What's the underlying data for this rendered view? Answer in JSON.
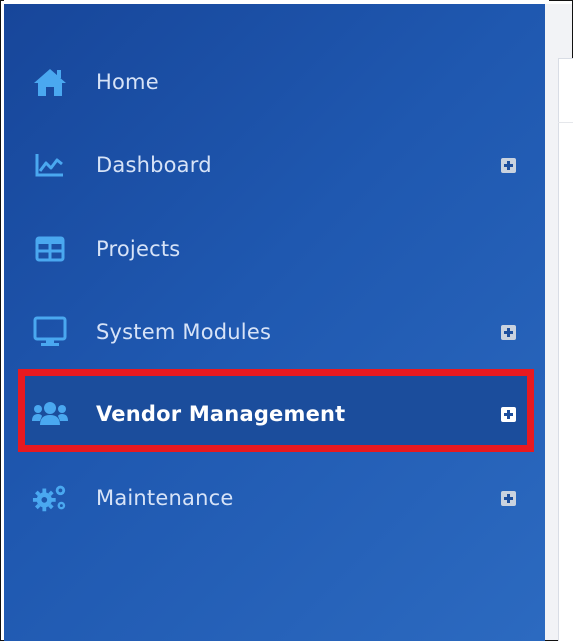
{
  "sidebar": {
    "items": [
      {
        "label": "Home",
        "icon": "home-icon",
        "expandable": false
      },
      {
        "label": "Dashboard",
        "icon": "chart-line-icon",
        "expandable": true
      },
      {
        "label": "Projects",
        "icon": "table-grid-icon",
        "expandable": false
      },
      {
        "label": "System Modules",
        "icon": "monitor-icon",
        "expandable": true
      },
      {
        "label": "Vendor Management",
        "icon": "users-icon",
        "expandable": true,
        "active": true
      },
      {
        "label": "Maintenance",
        "icon": "gears-icon",
        "expandable": true
      }
    ]
  },
  "colors": {
    "sidebar_gradient_start": "#17469a",
    "sidebar_gradient_end": "#2c6ac0",
    "icon_color": "#4aa8f0",
    "highlight_border": "#e8191f",
    "label_color": "#d7e3f7"
  }
}
